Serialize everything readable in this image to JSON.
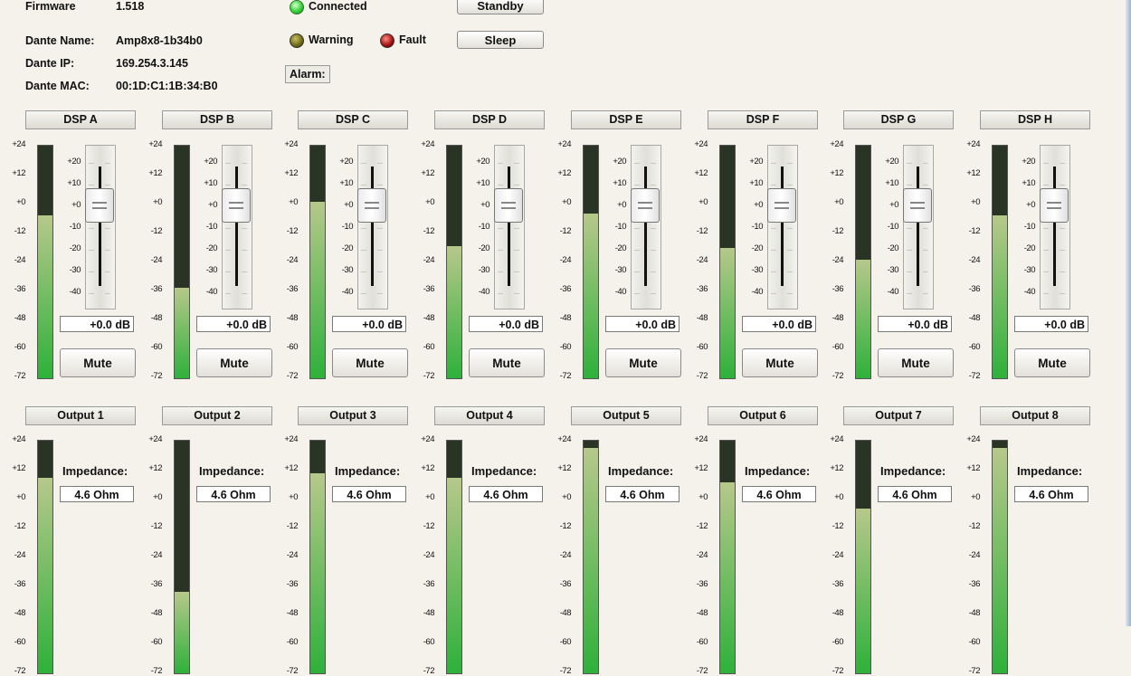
{
  "device": {
    "firmware_label": "Firmware",
    "firmware_value": "1.518",
    "dante_name_label": "Dante Name:",
    "dante_name_value": "Amp8x8-1b34b0",
    "dante_ip_label": "Dante IP:",
    "dante_ip_value": "169.254.3.145",
    "dante_mac_label": "Dante MAC:",
    "dante_mac_value": "00:1D:C1:1B:34:B0"
  },
  "status": {
    "connected_label": "Connected",
    "warning_label": "Warning",
    "fault_label": "Fault",
    "alarm_label": "Alarm:"
  },
  "buttons": {
    "standby_label": "Standby",
    "sleep_label": "Sleep"
  },
  "meter_scale": [
    "+24",
    "+12",
    "+0",
    "-12",
    "-24",
    "-36",
    "-48",
    "-60",
    "-72"
  ],
  "fader_scale": [
    "+20",
    "+10",
    "+0",
    "-10",
    "-20",
    "-30",
    "-40"
  ],
  "colors": {
    "meter_fill_top": "#b6c88a",
    "meter_fill_bottom": "#2eb13a",
    "meter_bg": "#2a3424"
  },
  "dsp_channels": [
    {
      "name": "DSP A",
      "gain": "+0.0 dB",
      "mute_label": "Mute",
      "meter_level": 0.7
    },
    {
      "name": "DSP B",
      "gain": "+0.0 dB",
      "mute_label": "Mute",
      "meter_level": 0.39
    },
    {
      "name": "DSP C",
      "gain": "+0.0 dB",
      "mute_label": "Mute",
      "meter_level": 0.76
    },
    {
      "name": "DSP D",
      "gain": "+0.0 dB",
      "mute_label": "Mute",
      "meter_level": 0.57
    },
    {
      "name": "DSP E",
      "gain": "+0.0 dB",
      "mute_label": "Mute",
      "meter_level": 0.71
    },
    {
      "name": "DSP F",
      "gain": "+0.0 dB",
      "mute_label": "Mute",
      "meter_level": 0.56
    },
    {
      "name": "DSP G",
      "gain": "+0.0 dB",
      "mute_label": "Mute",
      "meter_level": 0.51
    },
    {
      "name": "DSP H",
      "gain": "+0.0 dB",
      "mute_label": "Mute",
      "meter_level": 0.7
    }
  ],
  "outputs": [
    {
      "name": "Output 1",
      "impedance_label": "Impedance:",
      "impedance": "4.6 Ohm",
      "meter_level": 0.84
    },
    {
      "name": "Output 2",
      "impedance_label": "Impedance:",
      "impedance": "4.6 Ohm",
      "meter_level": 0.35
    },
    {
      "name": "Output 3",
      "impedance_label": "Impedance:",
      "impedance": "4.6 Ohm",
      "meter_level": 0.86
    },
    {
      "name": "Output 4",
      "impedance_label": "Impedance:",
      "impedance": "4.6 Ohm",
      "meter_level": 0.84
    },
    {
      "name": "Output 5",
      "impedance_label": "Impedance:",
      "impedance": "4.6 Ohm",
      "meter_level": 0.97
    },
    {
      "name": "Output 6",
      "impedance_label": "Impedance:",
      "impedance": "4.6 Ohm",
      "meter_level": 0.82
    },
    {
      "name": "Output 7",
      "impedance_label": "Impedance:",
      "impedance": "4.6 Ohm",
      "meter_level": 0.71
    },
    {
      "name": "Output 8",
      "impedance_label": "Impedance:",
      "impedance": "4.6 Ohm",
      "meter_level": 0.97
    }
  ]
}
